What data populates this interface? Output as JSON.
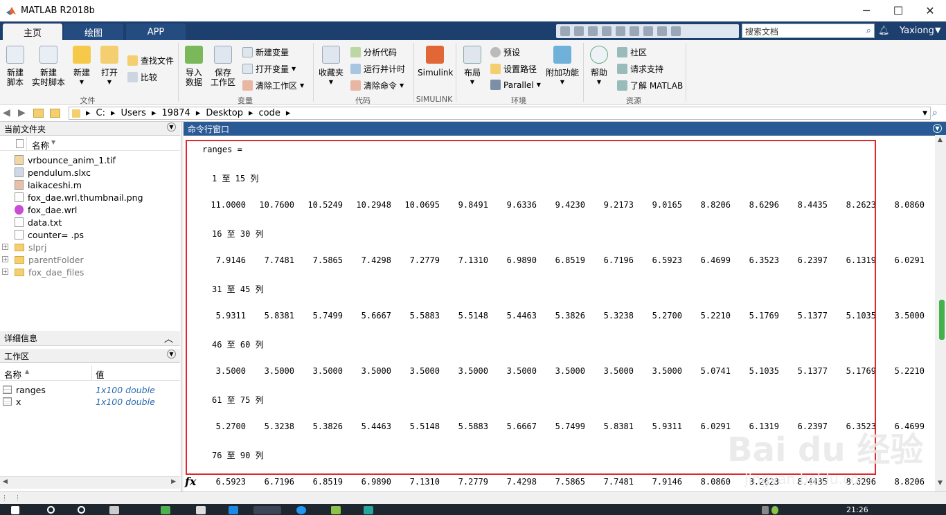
{
  "window": {
    "title": "MATLAB R2018b"
  },
  "tabs": [
    "主页",
    "绘图",
    "APP"
  ],
  "search": {
    "placeholder": "搜索文档"
  },
  "user": "Yaxiong",
  "ribbon": {
    "file": {
      "new_script": "新建\n脚本",
      "new_live": "新建\n实时脚本",
      "new": "新建",
      "open": "打开",
      "find_files": "查找文件",
      "compare": "比较",
      "group": "文件"
    },
    "variable": {
      "import": "导入\n数据",
      "save": "保存\n工作区",
      "new_var": "新建变量",
      "open_var": "打开变量",
      "clear_ws": "清除工作区",
      "group": "变量"
    },
    "code": {
      "favorites": "收藏夹",
      "analyze": "分析代码",
      "run_time": "运行并计时",
      "clear_cmd": "清除命令",
      "group": "代码"
    },
    "simulink": {
      "label": "Simulink",
      "group": "SIMULINK"
    },
    "env": {
      "layout": "布局",
      "prefs": "预设",
      "set_path": "设置路径",
      "parallel": "Parallel",
      "addons": "附加功能",
      "group": "环境"
    },
    "resources": {
      "help": "帮助",
      "community": "社区",
      "support": "请求支持",
      "learn": "了解 MATLAB",
      "group": "资源"
    }
  },
  "path": [
    "C:",
    "Users",
    "19874",
    "Desktop",
    "code"
  ],
  "current_folder": {
    "title": "当前文件夹",
    "column": "名称",
    "files": [
      {
        "name": "vrbounce_anim_1.tif",
        "kind": "tif"
      },
      {
        "name": "pendulum.slxc",
        "kind": "slxc"
      },
      {
        "name": "laikaceshi.m",
        "kind": "m"
      },
      {
        "name": "fox_dae.wrl.thumbnail.png",
        "kind": "file"
      },
      {
        "name": "fox_dae.wrl",
        "kind": "wrl"
      },
      {
        "name": "data.txt",
        "kind": "file"
      },
      {
        "name": "counter= .ps",
        "kind": "file"
      },
      {
        "name": "slprj",
        "kind": "folder"
      },
      {
        "name": "parentFolder",
        "kind": "folder"
      },
      {
        "name": "fox_dae_files",
        "kind": "folder"
      }
    ]
  },
  "details": {
    "title": "详细信息"
  },
  "workspace": {
    "title": "工作区",
    "col_name": "名称",
    "col_value": "值",
    "vars": [
      {
        "name": "ranges",
        "value": "1x100 double"
      },
      {
        "name": "x",
        "value": "1x100 double"
      }
    ]
  },
  "command_window": {
    "title": "命令行窗口",
    "var_header": "ranges =",
    "blocks": [
      {
        "label": "1 至 15 列",
        "values": [
          "11.0000",
          "10.7600",
          "10.5249",
          "10.2948",
          "10.0695",
          "9.8491",
          "9.6336",
          "9.4230",
          "9.2173",
          "9.0165",
          "8.8206",
          "8.6296",
          "8.4435",
          "8.2623",
          "8.0860"
        ]
      },
      {
        "label": "16 至 30 列",
        "values": [
          "7.9146",
          "7.7481",
          "7.5865",
          "7.4298",
          "7.2779",
          "7.1310",
          "6.9890",
          "6.8519",
          "6.7196",
          "6.5923",
          "6.4699",
          "6.3523",
          "6.2397",
          "6.1319",
          "6.0291"
        ]
      },
      {
        "label": "31 至 45 列",
        "values": [
          "5.9311",
          "5.8381",
          "5.7499",
          "5.6667",
          "5.5883",
          "5.5148",
          "5.4463",
          "5.3826",
          "5.3238",
          "5.2700",
          "5.2210",
          "5.1769",
          "5.1377",
          "5.1035",
          "3.5000"
        ]
      },
      {
        "label": "46 至 60 列",
        "values": [
          "3.5000",
          "3.5000",
          "3.5000",
          "3.5000",
          "3.5000",
          "3.5000",
          "3.5000",
          "3.5000",
          "3.5000",
          "3.5000",
          "5.0741",
          "5.1035",
          "5.1377",
          "5.1769",
          "5.2210"
        ]
      },
      {
        "label": "61 至 75 列",
        "values": [
          "5.2700",
          "5.3238",
          "5.3826",
          "5.4463",
          "5.5148",
          "5.5883",
          "5.6667",
          "5.7499",
          "5.8381",
          "5.9311",
          "6.0291",
          "6.1319",
          "6.2397",
          "6.3523",
          "6.4699"
        ]
      },
      {
        "label": "76 至 90 列",
        "values": [
          "6.5923",
          "6.7196",
          "6.8519",
          "6.9890",
          "7.1310",
          "7.2779",
          "7.4298",
          "7.5865",
          "7.7481",
          "7.9146",
          "8.0860",
          "8.2623",
          "8.4435",
          "8.6296",
          "8.8206"
        ]
      }
    ],
    "prompt_symbol": "fx"
  },
  "watermark": {
    "brand": "Bai du 经验",
    "url": "jingyan.baidu.com"
  },
  "taskbar": {
    "time": "21:26"
  },
  "colors": {
    "accent": "#1c3f6e",
    "cmd_header": "#2a5a95",
    "highlight": "#e3262b"
  }
}
